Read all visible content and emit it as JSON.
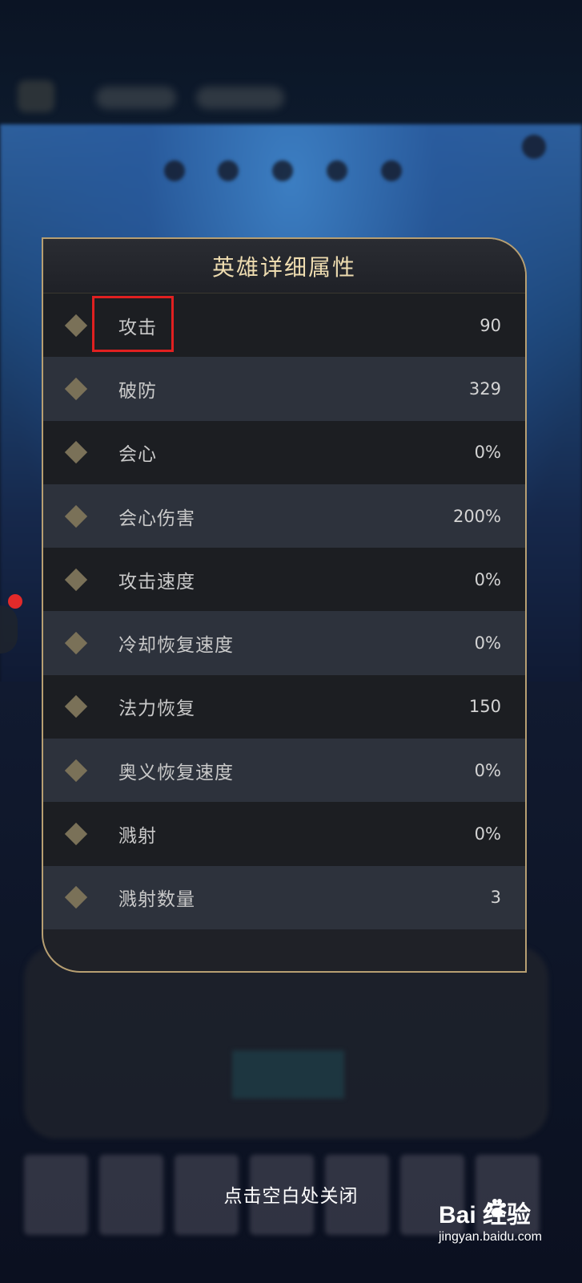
{
  "modal": {
    "title": "英雄详细属性",
    "rows": [
      {
        "label": "攻击",
        "value": "90"
      },
      {
        "label": "破防",
        "value": "329"
      },
      {
        "label": "会心",
        "value": "0%"
      },
      {
        "label": "会心伤害",
        "value": "200%"
      },
      {
        "label": "攻击速度",
        "value": "0%"
      },
      {
        "label": "冷却恢复速度",
        "value": "0%"
      },
      {
        "label": "法力恢复",
        "value": "150"
      },
      {
        "label": "奥义恢复速度",
        "value": "0%"
      },
      {
        "label": "溅射",
        "value": "0%"
      },
      {
        "label": "溅射数量",
        "value": "3"
      }
    ]
  },
  "close_hint": "点击空白处关闭",
  "watermark": {
    "brand": "Bai 经验",
    "url": "jingyan.baidu.com"
  },
  "colors": {
    "accent_border": "#b79f72",
    "title_text": "#eedcb0",
    "highlight": "#e02020"
  }
}
